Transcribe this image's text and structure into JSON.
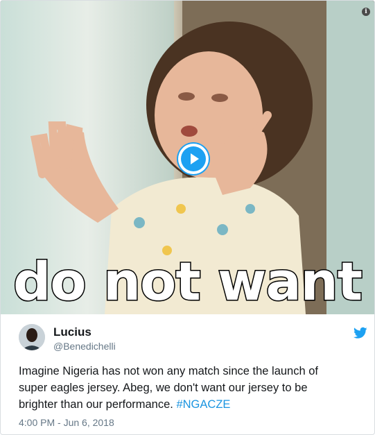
{
  "media": {
    "caption": "do not want",
    "play_icon": "play-icon",
    "info_icon_glyph": "i"
  },
  "tweet": {
    "author": {
      "name": "Lucius",
      "handle": "@Benedichelli"
    },
    "text": "Imagine Nigeria has not won any match since the launch of\nsuper eagles jersey. Abeg, we don't want our jersey to be\nbrighter than our performance. ",
    "hashtag": "#NGACZE",
    "timestamp": "4:00 PM - Jun 6, 2018",
    "brand_icon": "twitter-bird-icon"
  },
  "colors": {
    "accent": "#1da1f2",
    "link": "#1b95e0",
    "muted": "#657786"
  }
}
